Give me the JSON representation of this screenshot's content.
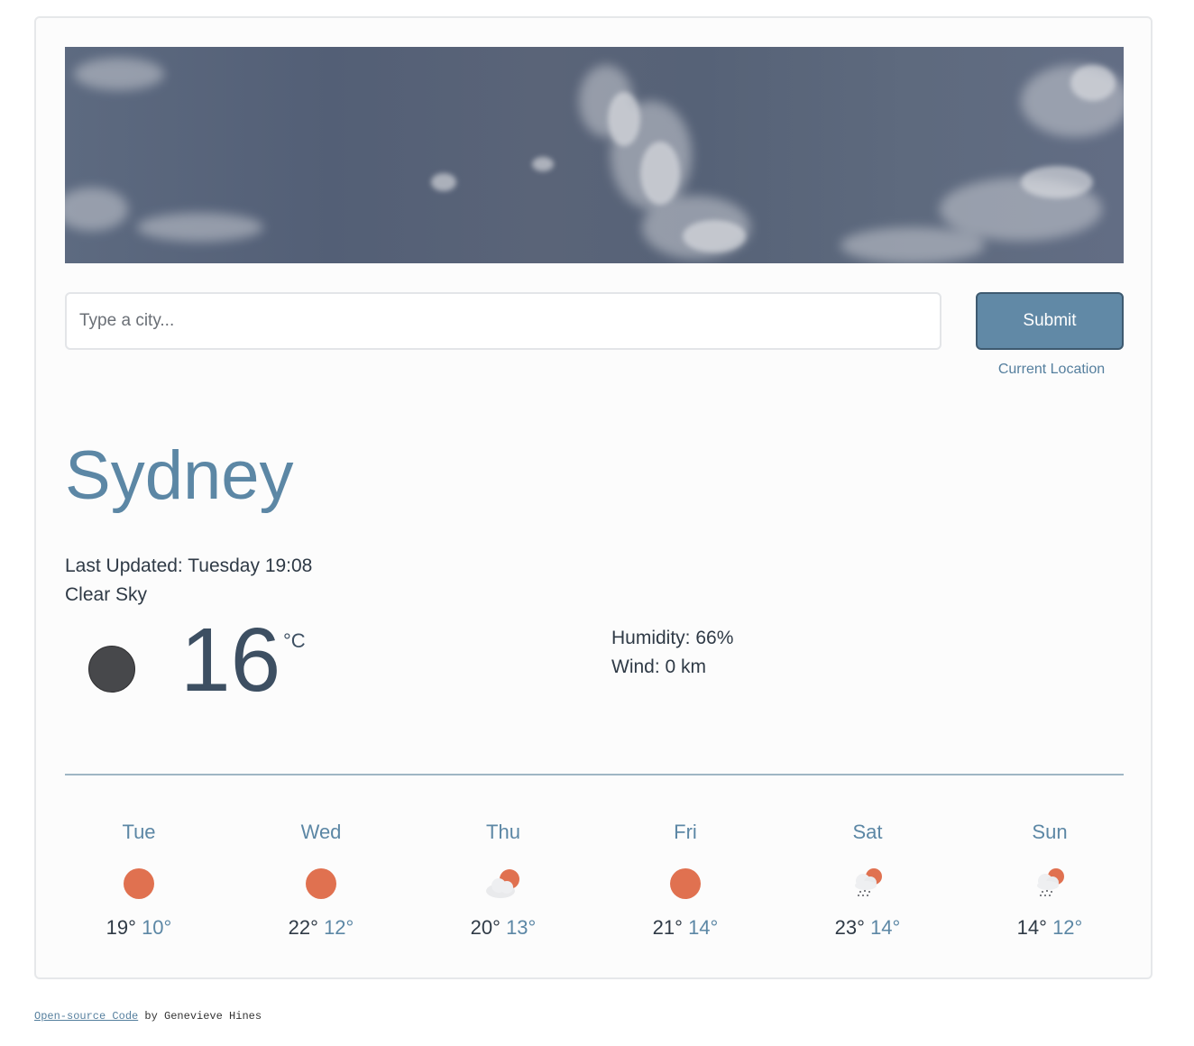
{
  "search": {
    "placeholder": "Type a city...",
    "submit_label": "Submit",
    "current_location_label": "Current Location"
  },
  "current": {
    "city": "Sydney",
    "last_updated": "Last Updated: Tuesday 19:08",
    "description": "Clear Sky",
    "temperature": "16",
    "unit": "°C",
    "humidity": "Humidity: 66%",
    "wind": "Wind: 0 km",
    "icon": "moon-icon"
  },
  "forecast": [
    {
      "day": "Tue",
      "max": "19°",
      "min": "10°",
      "icon": "sun-icon"
    },
    {
      "day": "Wed",
      "max": "22°",
      "min": "12°",
      "icon": "sun-icon"
    },
    {
      "day": "Thu",
      "max": "20°",
      "min": "13°",
      "icon": "cloud-sun-icon"
    },
    {
      "day": "Fri",
      "max": "21°",
      "min": "14°",
      "icon": "sun-icon"
    },
    {
      "day": "Sat",
      "max": "23°",
      "min": "14°",
      "icon": "rain-sun-icon"
    },
    {
      "day": "Sun",
      "max": "14°",
      "min": "12°",
      "icon": "rain-sun-icon"
    }
  ],
  "footer": {
    "link_text": "Open-source Code",
    "by_text": " by Genevieve Hines"
  },
  "colors": {
    "accent": "#5c87a5",
    "button": "#6189a6",
    "sun": "#e07150",
    "text": "#2f3a46"
  }
}
